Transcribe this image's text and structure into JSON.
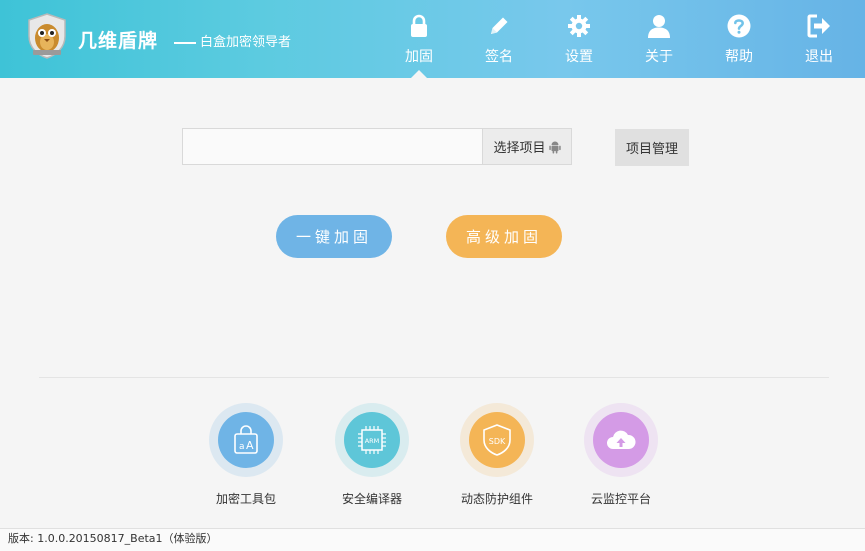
{
  "header": {
    "brand": "几维盾牌",
    "slogan": "白盒加密领导者",
    "nav": [
      {
        "label": "加固",
        "icon": "lock-icon"
      },
      {
        "label": "签名",
        "icon": "pencil-icon"
      },
      {
        "label": "设置",
        "icon": "gear-icon"
      },
      {
        "label": "关于",
        "icon": "user-icon"
      },
      {
        "label": "帮助",
        "icon": "help-icon"
      },
      {
        "label": "退出",
        "icon": "exit-icon"
      }
    ],
    "active_nav": "加固"
  },
  "project": {
    "input_value": "",
    "select_label": "选择项目",
    "manage_label": "项目管理"
  },
  "actions": {
    "quick_label": "一键加固",
    "advanced_label": "高级加固"
  },
  "tools": [
    {
      "label": "加密工具包",
      "icon": "text-aa-icon",
      "color": "#6fb4e6"
    },
    {
      "label": "安全编译器",
      "icon": "arm-chip-icon",
      "color": "#5ec6d8"
    },
    {
      "label": "动态防护组件",
      "icon": "sdk-shield-icon",
      "color": "#f4b556"
    },
    {
      "label": "云监控平台",
      "icon": "cloud-upload-icon",
      "color": "#d49be6"
    }
  ],
  "colors": {
    "header_start": "#3ec3d7",
    "header_end": "#66b3e6",
    "quick_button": "#6fb4e6",
    "advanced_button": "#f4b556"
  },
  "footer": {
    "version": "版本: 1.0.0.20150817_Beta1（体验版）"
  }
}
